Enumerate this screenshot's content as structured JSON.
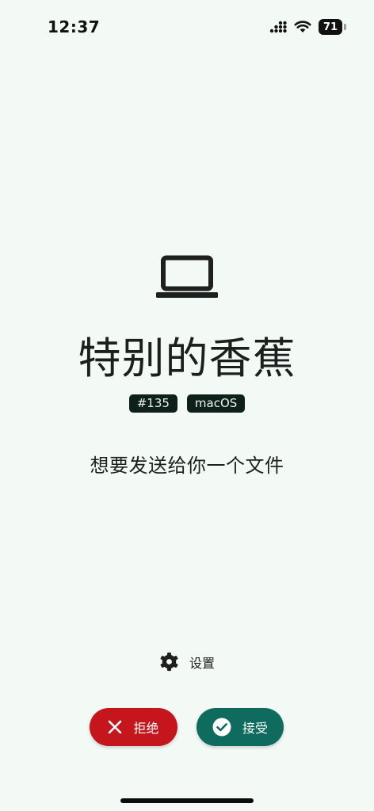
{
  "status_bar": {
    "time": "12:37",
    "battery_level": "71",
    "icons": [
      "cellular-signal-icon",
      "wifi-icon",
      "battery-icon"
    ]
  },
  "sender": {
    "device_icon": "laptop-icon",
    "name": "特别的香蕉",
    "badges": [
      "#135",
      "macOS"
    ]
  },
  "message": "想要发送给你一个文件",
  "settings": {
    "icon": "gear-icon",
    "label": "设置"
  },
  "actions": {
    "decline_label": "拒绝",
    "decline_icon": "close-icon",
    "accept_label": "接受",
    "accept_icon": "check-circle-icon"
  },
  "colors": {
    "background": "#f3faf6",
    "decline": "#c4161c",
    "accept": "#0e6b5d",
    "badge_bg": "#0e201a"
  }
}
